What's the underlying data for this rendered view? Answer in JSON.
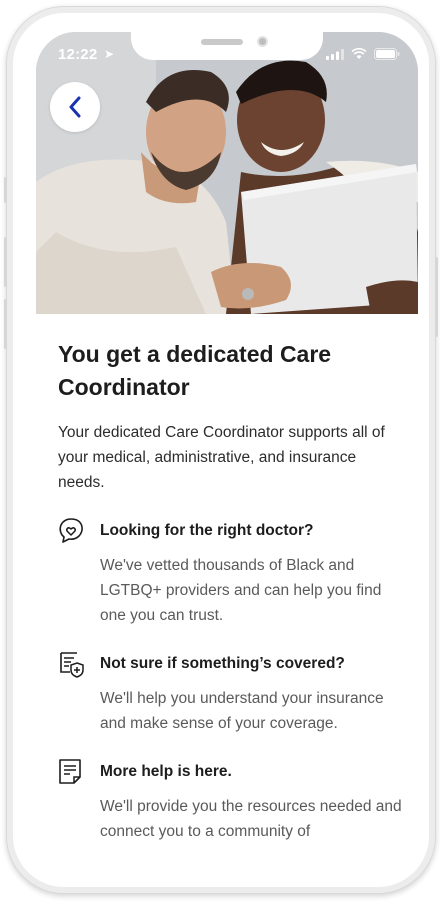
{
  "status_bar": {
    "time": "12:22"
  },
  "headline": "You get a dedicated Care Coordinator",
  "intro": "Your dedicated Care Coordinator supports all of your medical, administrative, and insurance needs.",
  "features": [
    {
      "icon": "chat-heart-icon",
      "title": "Looking for the right doctor?",
      "body": "We've vetted thousands of Black and LGTBQ+ providers and can help you find one you can trust."
    },
    {
      "icon": "document-shield-icon",
      "title": "Not sure if something’s covered?",
      "body": "We'll help you understand your insurance and make sense of your coverage."
    },
    {
      "icon": "notepad-icon",
      "title": "More help is here.",
      "body": "We'll provide you the resources needed and connect you to a community of"
    }
  ],
  "colors": {
    "accent": "#1a33b0",
    "text": "#1d1d1d",
    "muted": "#5a5a5a"
  }
}
